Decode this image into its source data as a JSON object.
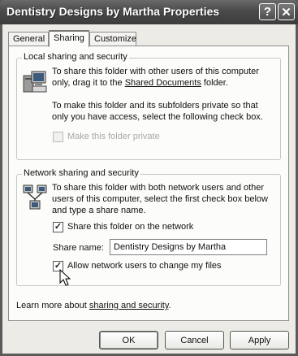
{
  "window": {
    "title": "Dentistry Designs by Martha Properties"
  },
  "title_buttons": {
    "help": "?",
    "close": "✕"
  },
  "tabs": [
    {
      "label": "General",
      "active": false
    },
    {
      "label": "Sharing",
      "active": true
    },
    {
      "label": "Customize",
      "active": false
    }
  ],
  "local": {
    "legend": "Local sharing and security",
    "para1_line1": "To share this folder with other users of this computer",
    "para1_line2_prefix": "only, drag it to the ",
    "para1_link": "Shared Documents",
    "para1_line2_suffix": " folder.",
    "para2_line1": "To make this folder and its subfolders private so that",
    "para2_line2": "only you have access, select the following check box.",
    "private_checkbox_label": "Make this folder private",
    "private_checked": false
  },
  "network": {
    "legend": "Network sharing and security",
    "para_line1": "To share this folder with both network users and other",
    "para_line2": "users of this computer, select the first check box below",
    "para_line3": "and type a share name.",
    "share_checkbox_label": "Share this folder on the network",
    "share_checked": true,
    "share_name_label": "Share name:",
    "share_name_value": "Dentistry Designs by Martha",
    "allow_change_label": "Allow network users to change my files",
    "allow_change_checked": true
  },
  "learn_more": {
    "prefix": "Learn more about ",
    "link": "sharing and security",
    "suffix": "."
  },
  "buttons": {
    "ok": "OK",
    "cancel": "Cancel",
    "apply": "Apply"
  },
  "check_glyph": "✓"
}
